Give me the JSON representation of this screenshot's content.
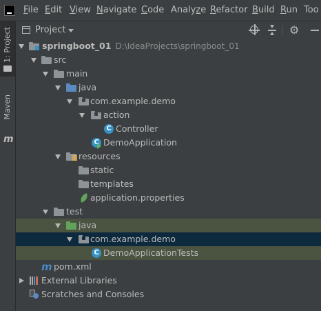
{
  "menu": {
    "items": [
      {
        "label": "File",
        "u": "F",
        "rest": "ile"
      },
      {
        "label": "Edit",
        "u": "E",
        "rest": "dit"
      },
      {
        "label": "View",
        "u": "V",
        "rest": "iew"
      },
      {
        "label": "Navigate",
        "u": "N",
        "rest": "avigate"
      },
      {
        "label": "Code",
        "u": "C",
        "rest": "ode"
      },
      {
        "label": "Analyze",
        "pre": "Analy",
        "u": "z",
        "rest": "e"
      },
      {
        "label": "Refactor",
        "u": "R",
        "rest": "efactor"
      },
      {
        "label": "Build",
        "u": "B",
        "rest": "uild"
      },
      {
        "label": "Run",
        "u": "R",
        "rest": "un"
      },
      {
        "label": "Too",
        "pre": "Too",
        "u": "",
        "rest": ""
      }
    ]
  },
  "toolstripe": {
    "project_label": "1: Project",
    "maven_label": "Maven"
  },
  "panel": {
    "title": "Project"
  },
  "tree": {
    "rows": [
      {
        "label": "springboot_01",
        "path": "D:\\IdeaProjects\\springboot_01",
        "bold": true,
        "depth": 0,
        "arrow": "down",
        "icon": "module-folder"
      },
      {
        "label": "src",
        "depth": 1,
        "arrow": "down",
        "icon": "folder-gray"
      },
      {
        "label": "main",
        "depth": 2,
        "arrow": "down",
        "icon": "folder-gray"
      },
      {
        "label": "java",
        "depth": 3,
        "arrow": "down",
        "icon": "folder-blue"
      },
      {
        "label": "com.example.demo",
        "depth": 4,
        "arrow": "down",
        "icon": "package"
      },
      {
        "label": "action",
        "depth": 5,
        "arrow": "down",
        "icon": "package"
      },
      {
        "label": "Controller",
        "depth": 6,
        "arrow": "",
        "icon": "class"
      },
      {
        "label": "DemoApplication",
        "depth": 5,
        "arrow": "",
        "icon": "spring-app"
      },
      {
        "label": "resources",
        "depth": 3,
        "arrow": "down",
        "icon": "resources"
      },
      {
        "label": "static",
        "depth": 4,
        "arrow": "",
        "icon": "folder-gray"
      },
      {
        "label": "templates",
        "depth": 4,
        "arrow": "",
        "icon": "folder-gray"
      },
      {
        "label": "application.properties",
        "depth": 4,
        "arrow": "",
        "icon": "leaf"
      },
      {
        "label": "test",
        "depth": 2,
        "arrow": "down",
        "icon": "folder-gray"
      },
      {
        "label": "java",
        "depth": 3,
        "arrow": "down",
        "icon": "folder-green",
        "state": "highlight"
      },
      {
        "label": "com.example.demo",
        "depth": 4,
        "arrow": "down",
        "icon": "package",
        "state": "selected"
      },
      {
        "label": "DemoApplicationTests",
        "depth": 5,
        "arrow": "",
        "icon": "class",
        "state": "highlight"
      },
      {
        "label": "pom.xml",
        "depth": 1,
        "arrow": "",
        "icon": "maven"
      },
      {
        "label": "External Libraries",
        "depth": 0,
        "arrow": "right",
        "icon": "libraries"
      },
      {
        "label": "Scratches and Consoles",
        "depth": 0,
        "arrow": "",
        "icon": "scratches"
      }
    ]
  }
}
